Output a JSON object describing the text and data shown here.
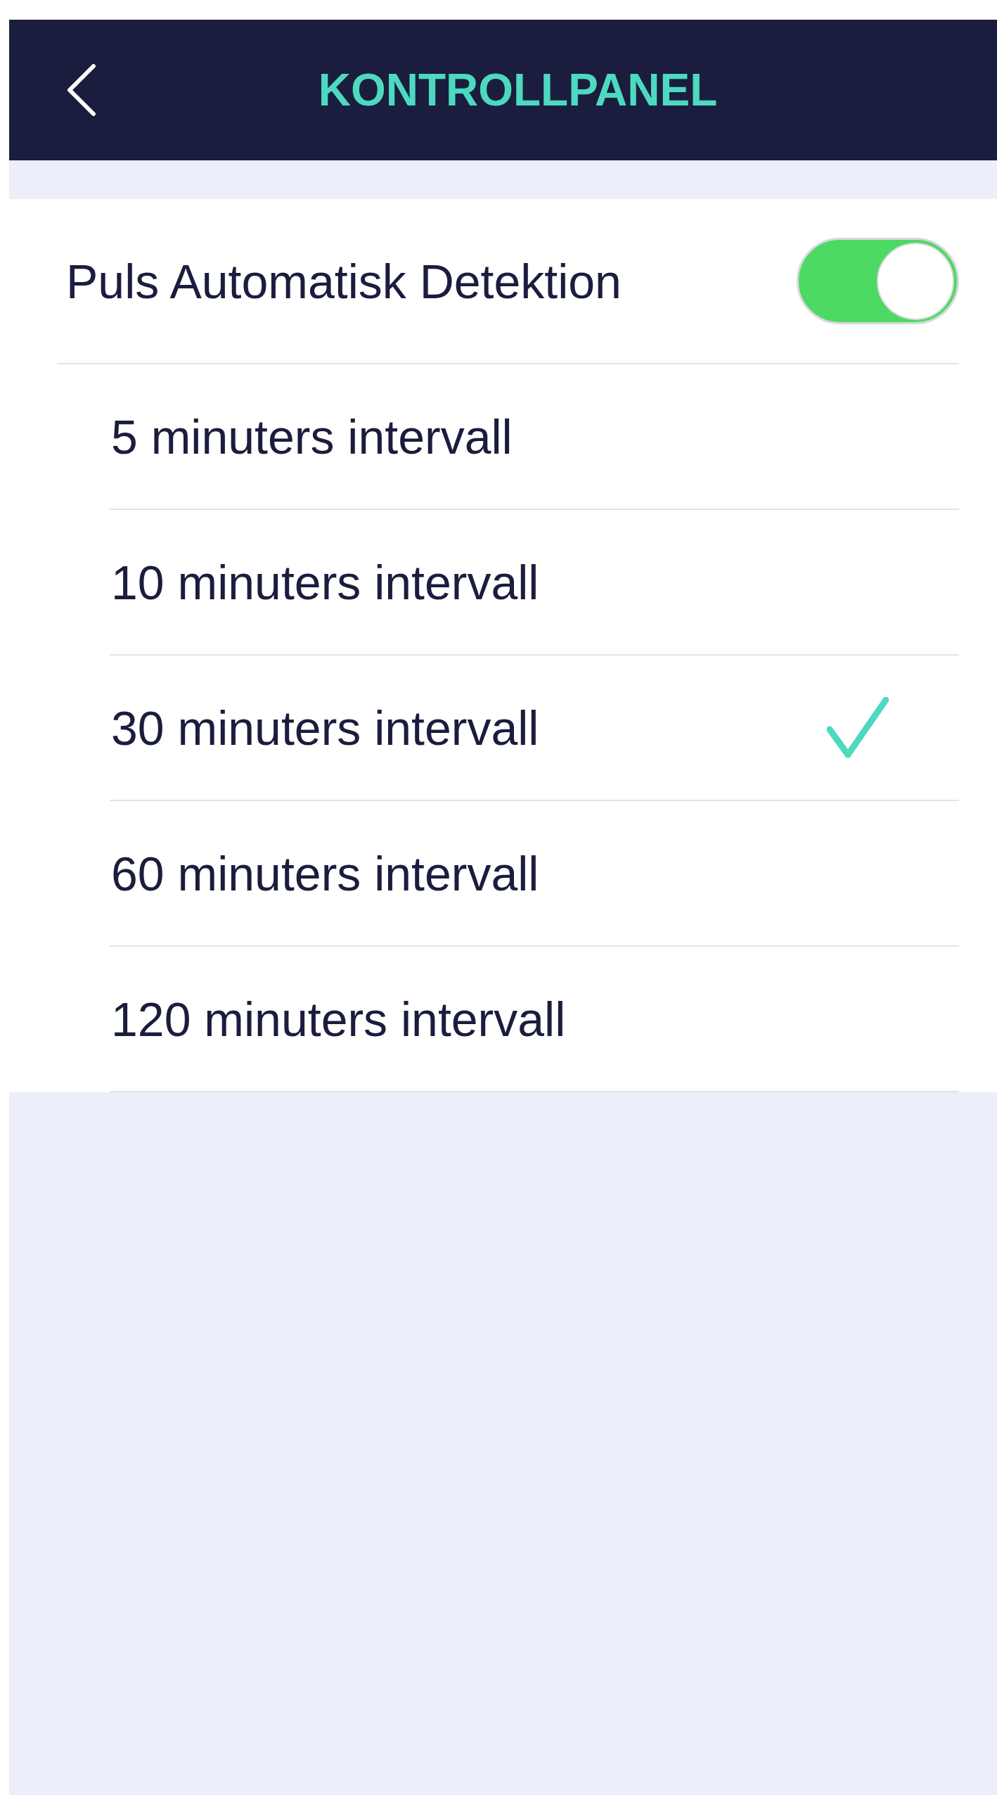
{
  "header": {
    "title": "KONTROLLPANEL"
  },
  "auto_detection": {
    "label": "Puls Automatisk Detektion",
    "on": true
  },
  "intervals": [
    {
      "label": "5 minuters intervall",
      "selected": false
    },
    {
      "label": "10 minuters intervall",
      "selected": false
    },
    {
      "label": "30 minuters intervall",
      "selected": true
    },
    {
      "label": "60 minuters intervall",
      "selected": false
    },
    {
      "label": "120 minuters intervall",
      "selected": false
    }
  ]
}
